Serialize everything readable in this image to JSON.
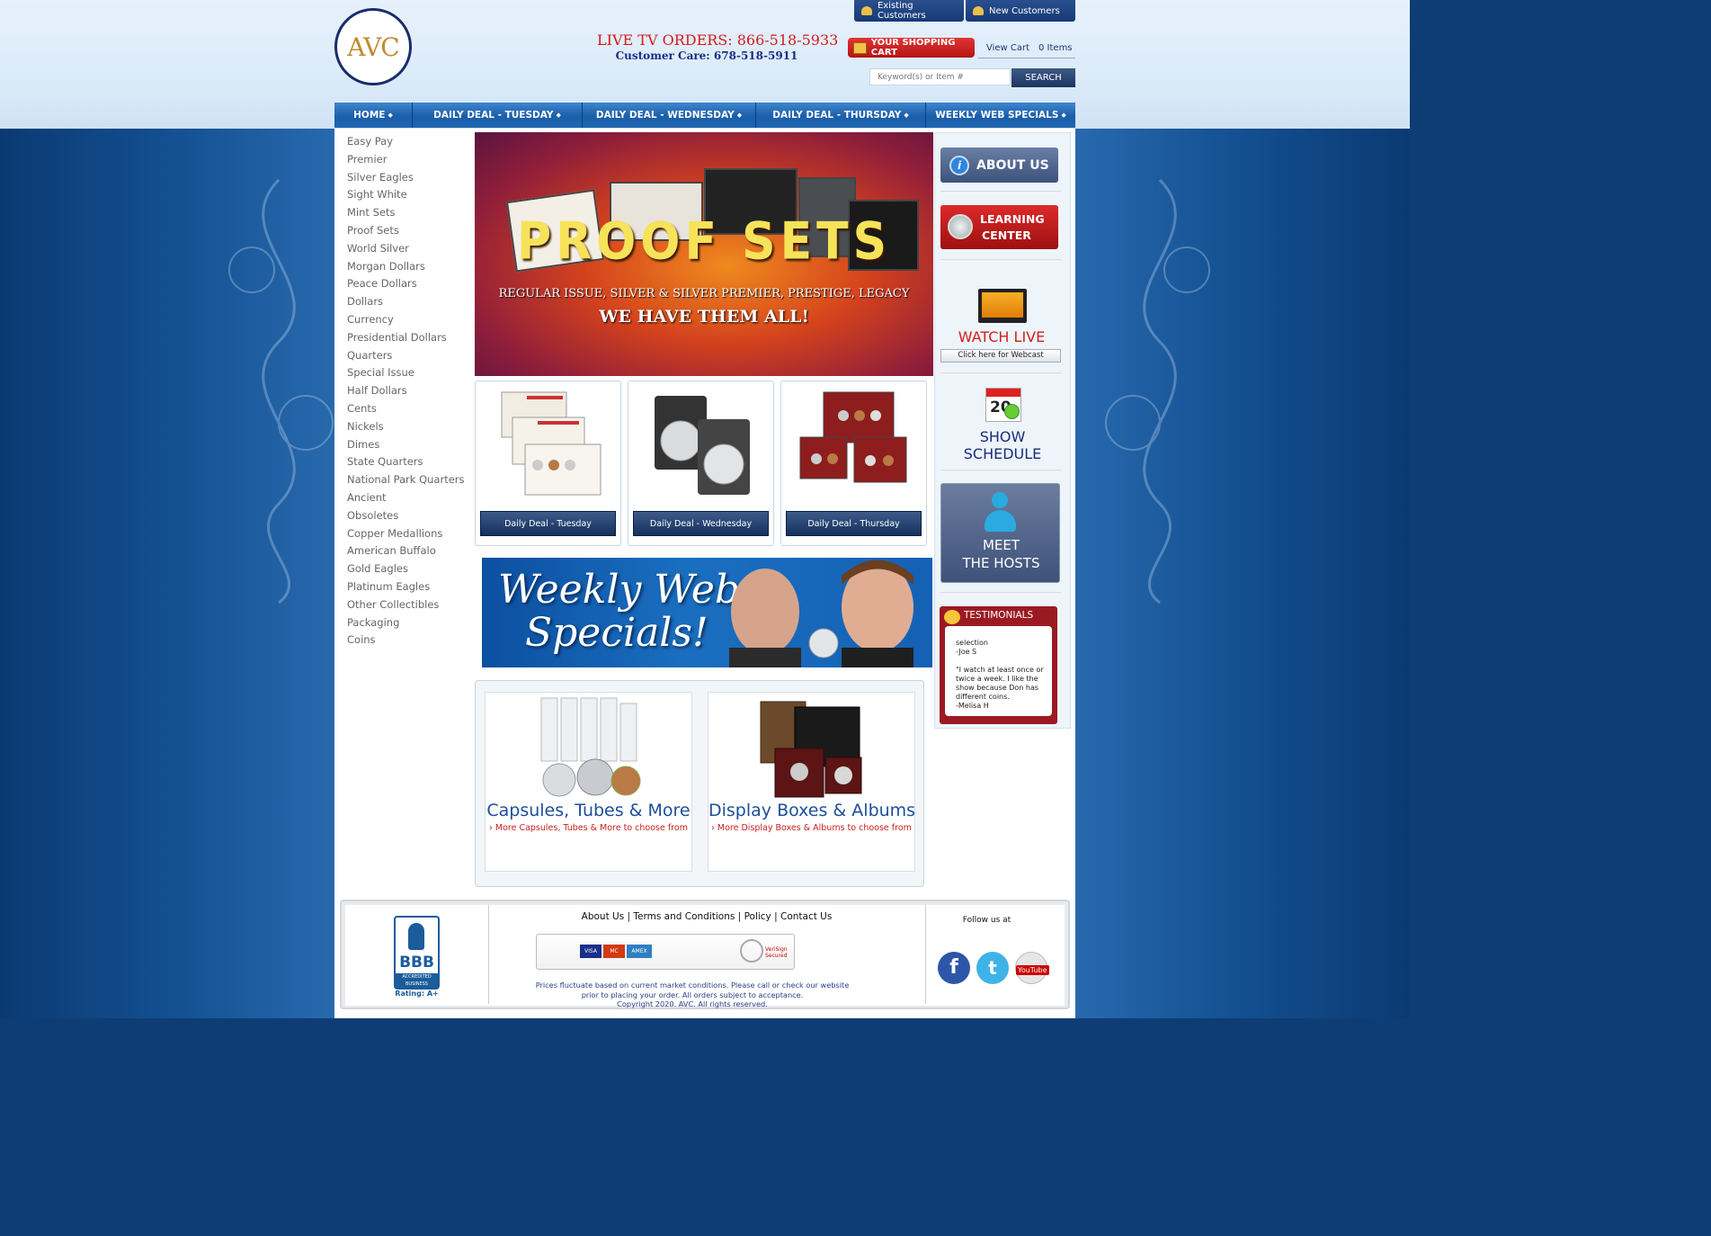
{
  "header": {
    "logo_text": "AVC",
    "live_tv_orders": "LIVE TV ORDERS: 866-518-5933",
    "customer_care": "Customer Care: 678-518-5911",
    "existing_customers": "Existing Customers",
    "new_customers": "New Customers",
    "cart_label": "YOUR SHOPPING CART",
    "view_cart": "View Cart",
    "items_count": "0 Items",
    "search_placeholder": "Keyword(s) or Item #",
    "search_button": "SEARCH"
  },
  "nav": [
    {
      "label": "HOME"
    },
    {
      "label": "DAILY DEAL - TUESDAY"
    },
    {
      "label": "DAILY DEAL - WEDNESDAY"
    },
    {
      "label": "DAILY DEAL - THURSDAY"
    },
    {
      "label": "WEEKLY WEB SPECIALS"
    }
  ],
  "sidebar": {
    "categories": [
      "Easy Pay",
      "Premier",
      "Silver Eagles",
      "Sight White",
      "Mint Sets",
      "Proof Sets",
      "World Silver",
      "Morgan Dollars",
      "Peace Dollars",
      "Dollars",
      "Currency",
      "Presidential Dollars",
      "Quarters",
      "Special Issue",
      "Half Dollars",
      "Cents",
      "Nickels",
      "Dimes",
      "State Quarters",
      "National Park Quarters",
      "Ancient",
      "Obsoletes",
      "Copper Medallions",
      "American Buffalo",
      "Gold Eagles",
      "Platinum Eagles",
      "Other Collectibles",
      "Packaging",
      "Coins"
    ]
  },
  "hero": {
    "title": "PROOF SETS",
    "subtitle": "REGULAR ISSUE, SILVER & SILVER PREMIER, PRESTIGE, LEGACY",
    "tagline": "WE HAVE THEM ALL!"
  },
  "deals": [
    {
      "button": "Daily Deal - Tuesday"
    },
    {
      "button": "Daily Deal - Wednesday"
    },
    {
      "button": "Daily Deal - Thursday"
    }
  ],
  "weekly_banner": {
    "line1": "Weekly Web",
    "line2": "Specials!"
  },
  "accessories": [
    {
      "title": "Capsules, Tubes & More",
      "more": "More Capsules, Tubes & More to choose from"
    },
    {
      "title": "Display Boxes & Albums",
      "more": "More Display Boxes & Albums to choose from"
    }
  ],
  "right": {
    "about": "ABOUT US",
    "learning_1": "LEARNING",
    "learning_2": "CENTER",
    "watch_live": "WATCH LIVE",
    "webcast": "Click here for Webcast",
    "cal_day": "20",
    "show_1": "SHOW",
    "show_2": "SCHEDULE",
    "meet_1": "MEET",
    "meet_2": "THE HOSTS",
    "testimonials_title": "TESTIMONIALS",
    "testimonial_text": "selection\n-Joe S\n\n\"I watch at least once or twice a week. I like the show because Don has different coins.\n-Melisa H"
  },
  "footer": {
    "links": [
      "About Us",
      "Terms and Conditions",
      "Policy",
      "Contact Us"
    ],
    "bbb_accredited": "ACCREDITED BUSINESS",
    "bbb_rating": "Rating: A+",
    "verisign": "VeriSign Secured",
    "disclaimer_1": "Prices fluctuate based on current market conditions. Please call or check our website",
    "disclaimer_2": "prior to placing your order. All orders subject to acceptance.",
    "copyright": "Copyright 2020. AVC. All rights reserved.",
    "follow": "Follow us at",
    "youtube": "YouTube"
  },
  "colors": {
    "nav_blue": "#1b5ea9",
    "accent_red": "#d21f1f",
    "dark_navy": "#1a2c6b"
  }
}
